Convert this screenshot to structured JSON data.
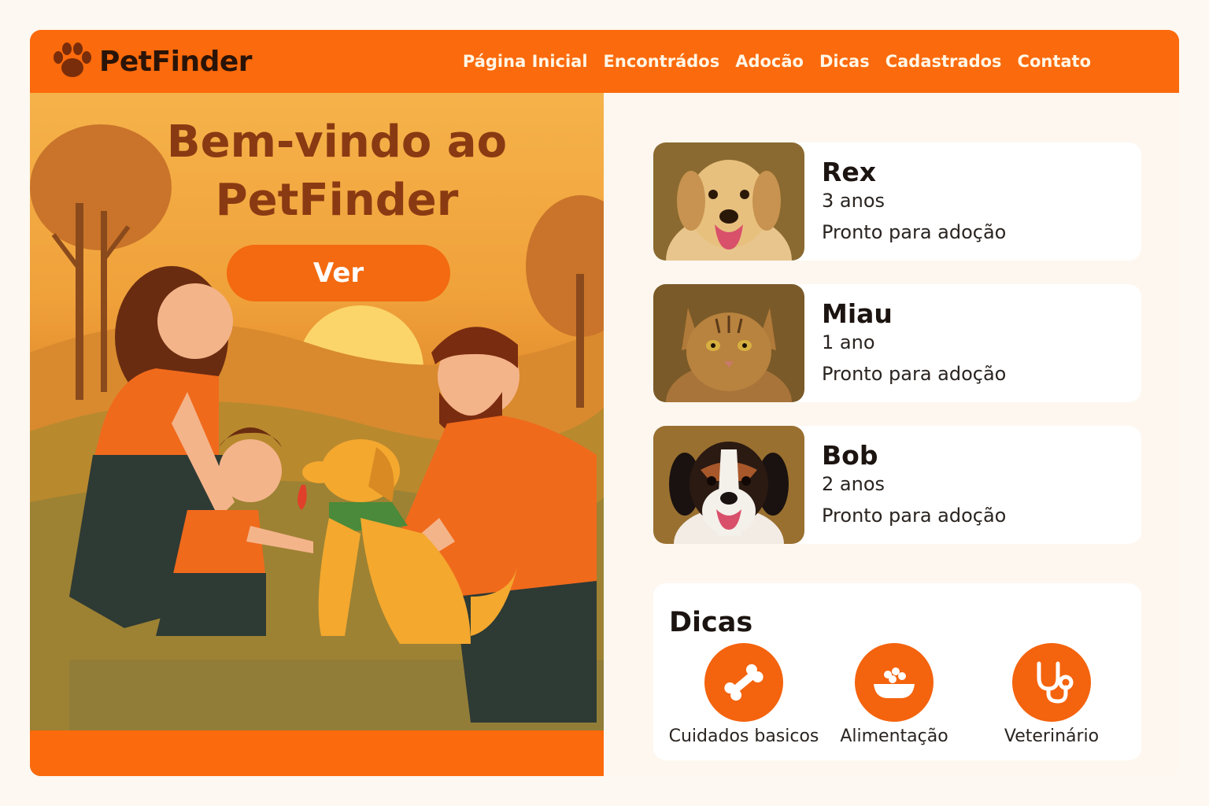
{
  "brand": {
    "name": "PetFinder",
    "color": "#fb6a0c"
  },
  "nav": {
    "items": [
      {
        "label": "Página Inicial"
      },
      {
        "label": "Encontrádos"
      },
      {
        "label": "Adocão"
      },
      {
        "label": "Dicas"
      },
      {
        "label": "Cadastrados"
      },
      {
        "label": "Contato"
      }
    ]
  },
  "hero": {
    "title_line1": "Bem-vindo ao",
    "title_line2": "PetFinder",
    "button_label": "Ver"
  },
  "pets": [
    {
      "name": "Rex",
      "age": "3 anos",
      "status": "Pronto para adoção",
      "photo": "golden-retriever-photo"
    },
    {
      "name": "Miau",
      "age": "1 ano",
      "status": "Pronto para adoção",
      "photo": "tabby-cat-photo"
    },
    {
      "name": "Bob",
      "age": "2 anos",
      "status": "Pronto para adoção",
      "photo": "beagle-mix-photo"
    }
  ],
  "tips": {
    "title": "Dicas",
    "items": [
      {
        "label": "Cuidados basicos",
        "icon": "bone-icon"
      },
      {
        "label": "Alimentação",
        "icon": "food-bowl-icon"
      },
      {
        "label": "Veterinário",
        "icon": "stethoscope-icon"
      }
    ]
  }
}
